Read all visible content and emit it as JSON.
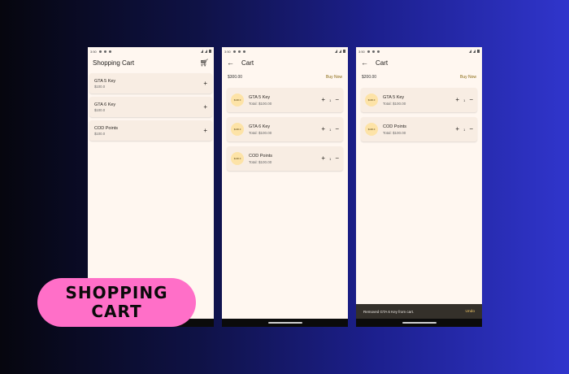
{
  "status_time": "3:50",
  "phone1": {
    "title": "Shopping Cart",
    "items": [
      {
        "name": "GTA 5 Key",
        "price": "$100.0"
      },
      {
        "name": "GTA 6 Key",
        "price": "$100.0"
      },
      {
        "name": "COD Points",
        "price": "$100.0"
      }
    ]
  },
  "phone2": {
    "title": "Cart",
    "total": "$300.00",
    "buy_label": "Buy Now",
    "items": [
      {
        "avatar": "$100.0",
        "name": "GTA 5 Key",
        "total": "Total: $100.00",
        "qty": "1"
      },
      {
        "avatar": "$100.0",
        "name": "GTA 6 Key",
        "total": "Total: $100.00",
        "qty": "1"
      },
      {
        "avatar": "$100.0",
        "name": "COD Points",
        "total": "Total: $100.00",
        "qty": "1"
      }
    ]
  },
  "phone3": {
    "title": "Cart",
    "total": "$200.00",
    "buy_label": "Buy Now",
    "items": [
      {
        "avatar": "$100.0",
        "name": "GTA 5 Key",
        "total": "Total: $100.00",
        "qty": "1"
      },
      {
        "avatar": "$100.0",
        "name": "COD Points",
        "total": "Total: $100.00",
        "qty": "1"
      }
    ],
    "snackbar_text": "Removed GTA 6 Key from cart.",
    "snackbar_action": "Undo"
  },
  "badge": {
    "line1": "SHOPPING",
    "line2": "CART"
  },
  "icons": {
    "cart": "shopping-cart-icon",
    "back": "arrow-back-icon",
    "plus": "plus-icon",
    "minus": "minus-icon"
  },
  "colors": {
    "surface": "#fff7f0",
    "card": "#f8ede3",
    "accent": "#8a6a12",
    "badge": "#ff6fc8",
    "avatar": "#fde3a7",
    "snackbar": "#34302a"
  }
}
